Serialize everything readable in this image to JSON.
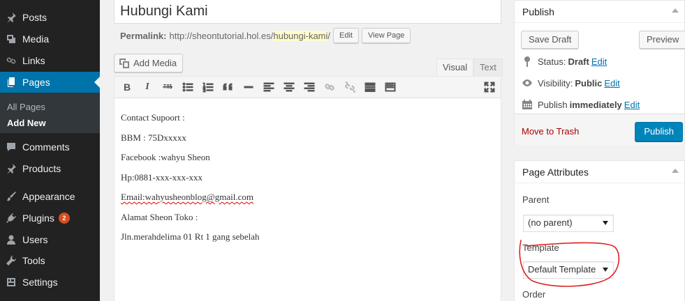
{
  "sidebar": {
    "items": [
      {
        "label": "Posts",
        "icon": "pushpin-icon"
      },
      {
        "label": "Media",
        "icon": "media-icon"
      },
      {
        "label": "Links",
        "icon": "link-icon"
      },
      {
        "label": "Pages",
        "icon": "pages-icon"
      },
      {
        "label": "Comments",
        "icon": "comment-icon"
      },
      {
        "label": "Products",
        "icon": "pushpin-icon"
      },
      {
        "label": "Appearance",
        "icon": "brush-icon"
      },
      {
        "label": "Plugins",
        "icon": "plugin-icon",
        "badge": "2"
      },
      {
        "label": "Users",
        "icon": "users-icon"
      },
      {
        "label": "Tools",
        "icon": "wrench-icon"
      },
      {
        "label": "Settings",
        "icon": "settings-icon"
      }
    ],
    "submenu": {
      "all_pages": "All Pages",
      "add_new": "Add New"
    }
  },
  "editor": {
    "title": "Hubungi Kami",
    "permalink_label": "Permalink:",
    "permalink_base": "http://sheontutorial.hol.es/",
    "permalink_slug": "hubungi-kami",
    "permalink_end": "/",
    "edit_label": "Edit",
    "view_page_label": "View Page",
    "add_media_label": "Add Media",
    "tab_visual": "Visual",
    "tab_text": "Text",
    "content_lines": [
      "Contact Supoort :",
      "BBM : 75Dxxxxx",
      "Facebook :wahyu Sheon",
      "Hp:0881-xxx-xxx-xxx",
      "Email:wahyusheonblog@gmail.com",
      "Alamat Sheon Toko :",
      "Jln.merahdelima 01 Rt 1 gang sebelah"
    ]
  },
  "publish": {
    "title": "Publish",
    "save_draft": "Save Draft",
    "preview": "Preview",
    "status_label": "Status:",
    "status_value": "Draft",
    "visibility_label": "Visibility:",
    "visibility_value": "Public",
    "publish_label": "Publish",
    "publish_value": "immediately",
    "edit": "Edit",
    "move_to_trash": "Move to Trash",
    "publish_button": "Publish"
  },
  "page_attributes": {
    "title": "Page Attributes",
    "parent_label": "Parent",
    "parent_value": "(no parent)",
    "template_label": "Template",
    "template_value": "Default Template",
    "order_label": "Order"
  },
  "colors": {
    "sidebar_bg": "#222222",
    "accent": "#0073aa",
    "publish_button": "#0085ba",
    "annotation": "#e02020"
  }
}
